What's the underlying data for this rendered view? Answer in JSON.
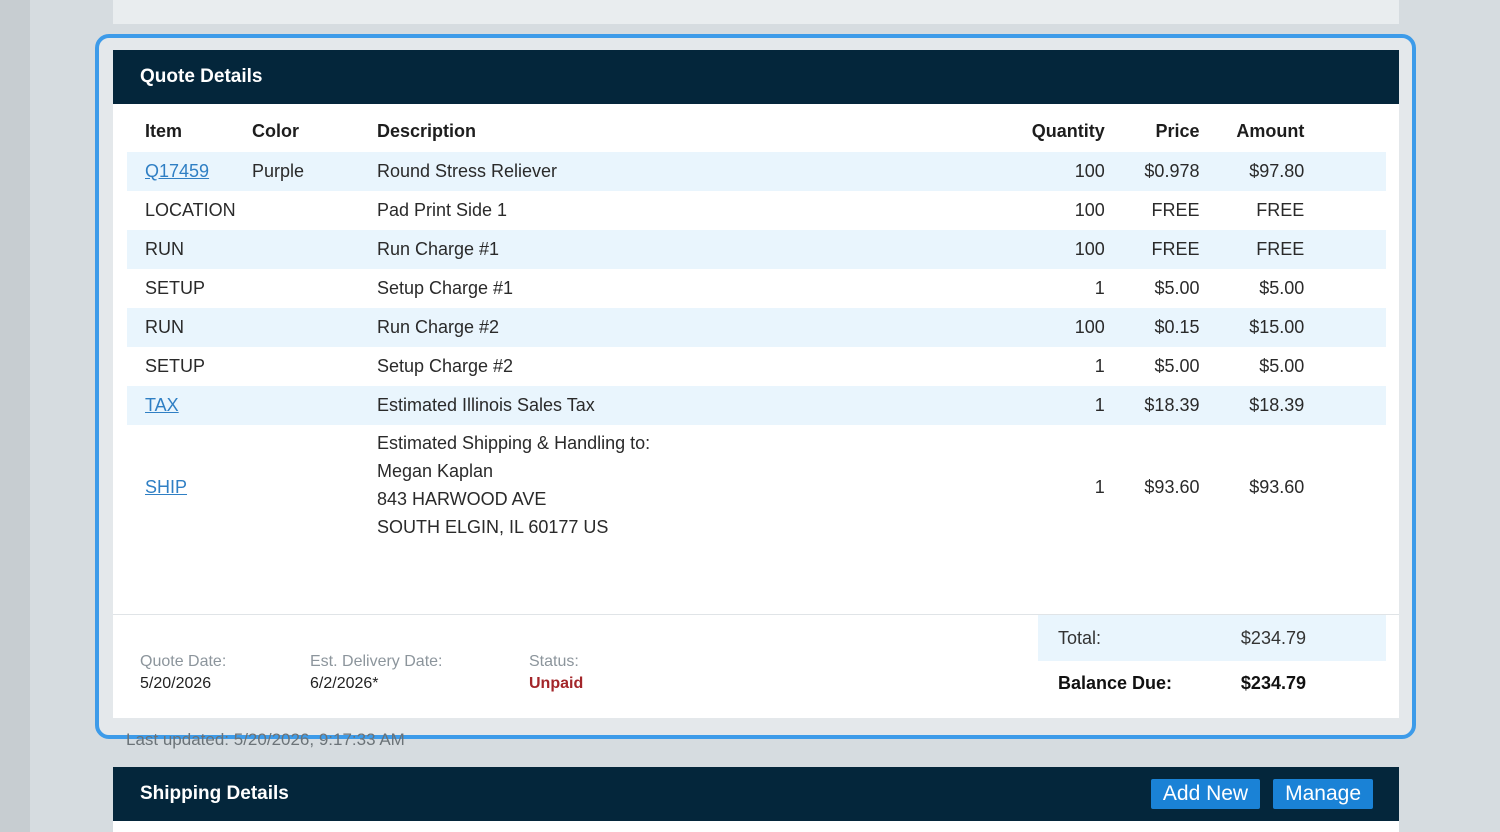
{
  "quote": {
    "title": "Quote Details",
    "columns": [
      "Item",
      "Color",
      "Description",
      "Quantity",
      "Price",
      "Amount"
    ],
    "rows": [
      {
        "item": "Q17459",
        "color": "Purple",
        "description": "Round Stress Reliever",
        "quantity": "100",
        "price": "$0.978",
        "amount": "$97.80"
      },
      {
        "item": "LOCATION",
        "color": "",
        "description": "Pad Print Side 1",
        "quantity": "100",
        "price": "FREE",
        "amount": "FREE"
      },
      {
        "item": "RUN",
        "color": "",
        "description": "Run Charge #1",
        "quantity": "100",
        "price": "FREE",
        "amount": "FREE"
      },
      {
        "item": "SETUP",
        "color": "",
        "description": "Setup Charge #1",
        "quantity": "1",
        "price": "$5.00",
        "amount": "$5.00"
      },
      {
        "item": "RUN",
        "color": "",
        "description": "Run Charge #2",
        "quantity": "100",
        "price": "$0.15",
        "amount": "$15.00"
      },
      {
        "item": "SETUP",
        "color": "",
        "description": "Setup Charge #2",
        "quantity": "1",
        "price": "$5.00",
        "amount": "$5.00"
      },
      {
        "item": "TAX",
        "color": "",
        "description": "Estimated Illinois Sales Tax",
        "quantity": "1",
        "price": "$18.39",
        "amount": "$18.39"
      }
    ],
    "ship": {
      "item": "SHIP",
      "description_lines": [
        "Estimated Shipping & Handling to:",
        "Megan Kaplan",
        "843 HARWOOD AVE",
        "SOUTH ELGIN, IL 60177 US"
      ],
      "quantity": "1",
      "price": "$93.60",
      "amount": "$93.60"
    },
    "footer": {
      "quote_date_label": "Quote Date:",
      "quote_date": "5/20/2026",
      "delivery_label": "Est. Delivery Date:",
      "delivery_date": "6/2/2026*",
      "status_label": "Status:",
      "status": "Unpaid",
      "total_label": "Total:",
      "total": "$234.79",
      "balance_label": "Balance Due:",
      "balance": "$234.79"
    }
  },
  "last_updated": "Last updated: 5/20/2026, 9:17:33 AM",
  "shipping": {
    "title": "Shipping Details",
    "add_new_label": "Add New",
    "manage_label": "Manage"
  },
  "colors": {
    "header_bg": "#04263b",
    "highlight": "#3d9be9",
    "link": "#2f7fc4",
    "status_unpaid": "#a3262a",
    "button": "#1a82d6"
  }
}
